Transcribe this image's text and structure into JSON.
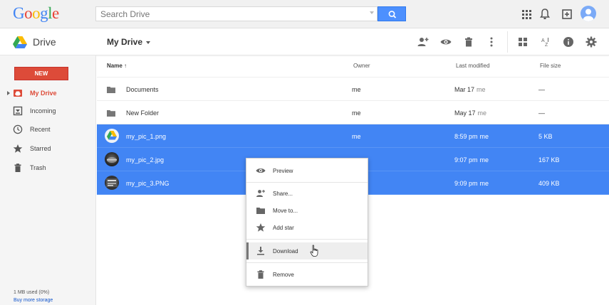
{
  "topbar": {
    "logo_letters": [
      {
        "ch": "G",
        "color": "#4285f4"
      },
      {
        "ch": "o",
        "color": "#ea4335"
      },
      {
        "ch": "o",
        "color": "#fbbc05"
      },
      {
        "ch": "g",
        "color": "#4285f4"
      },
      {
        "ch": "l",
        "color": "#34a853"
      },
      {
        "ch": "e",
        "color": "#ea4335"
      }
    ],
    "search_placeholder": "Search Drive"
  },
  "appbar": {
    "brand": "Drive",
    "title": "My Drive"
  },
  "sidebar": {
    "new_label": "NEW",
    "items": [
      {
        "label": "My Drive",
        "icon": "my-drive-icon",
        "active": true
      },
      {
        "label": "Incoming",
        "icon": "incoming-icon",
        "active": false
      },
      {
        "label": "Recent",
        "icon": "clock-icon",
        "active": false
      },
      {
        "label": "Starred",
        "icon": "star-icon",
        "active": false
      },
      {
        "label": "Trash",
        "icon": "trash-icon",
        "active": false
      }
    ],
    "storage": "1 MB used (0%)",
    "buy_more": "Buy more storage"
  },
  "list": {
    "columns": {
      "name": "Name",
      "sort_arrow": "↑",
      "owner": "Owner",
      "modified": "Last modified",
      "size": "File size"
    },
    "rows": [
      {
        "name": "Documents",
        "owner": "me",
        "modified": "Mar 17",
        "modified_by": "me",
        "size": "—",
        "selected": false,
        "kind": "folder"
      },
      {
        "name": "New Folder",
        "owner": "me",
        "modified": "May 17",
        "modified_by": "me",
        "size": "—",
        "selected": false,
        "kind": "folder"
      },
      {
        "name": "my_pic_1.png",
        "owner": "me",
        "modified": "8:59 pm",
        "modified_by": "me",
        "size": "5 KB",
        "selected": true,
        "kind": "drive-thumb"
      },
      {
        "name": "my_pic_2.jpg",
        "owner": "",
        "modified": "9:07 pm",
        "modified_by": "me",
        "size": "167 KB",
        "selected": true,
        "kind": "photo-thumb"
      },
      {
        "name": "my_pic_3.PNG",
        "owner": "",
        "modified": "9:09 pm",
        "modified_by": "me",
        "size": "409 KB",
        "selected": true,
        "kind": "photo-thumb-2"
      }
    ]
  },
  "context_menu": {
    "items": [
      {
        "label": "Preview",
        "icon": "eye-icon"
      },
      {
        "label": "Share...",
        "icon": "add-person-icon"
      },
      {
        "label": "Move to...",
        "icon": "folder-icon"
      },
      {
        "label": "Add star",
        "icon": "star-icon"
      },
      {
        "label": "Download",
        "icon": "download-icon"
      },
      {
        "label": "Remove",
        "icon": "trash-icon"
      }
    ],
    "hovered": "Download"
  },
  "colors": {
    "accent_blue": "#4285f4",
    "new_red": "#dd4b39",
    "selected_row": "#4285f4"
  }
}
